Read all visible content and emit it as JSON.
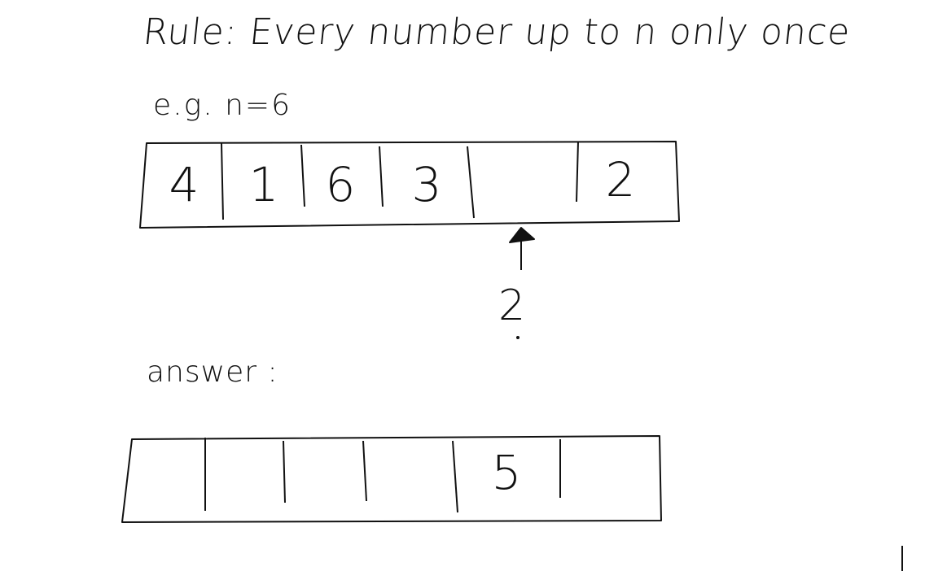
{
  "title": "Rule: Every number up to n only once",
  "example": "e.g. n=6",
  "example_cells": [
    "4",
    "1",
    "6",
    "3",
    "",
    "2"
  ],
  "pointer_label": "2",
  "answer_label": "answer :",
  "answer_cells": [
    "",
    "",
    "",
    "",
    "5",
    ""
  ],
  "ink_color": "#111111"
}
